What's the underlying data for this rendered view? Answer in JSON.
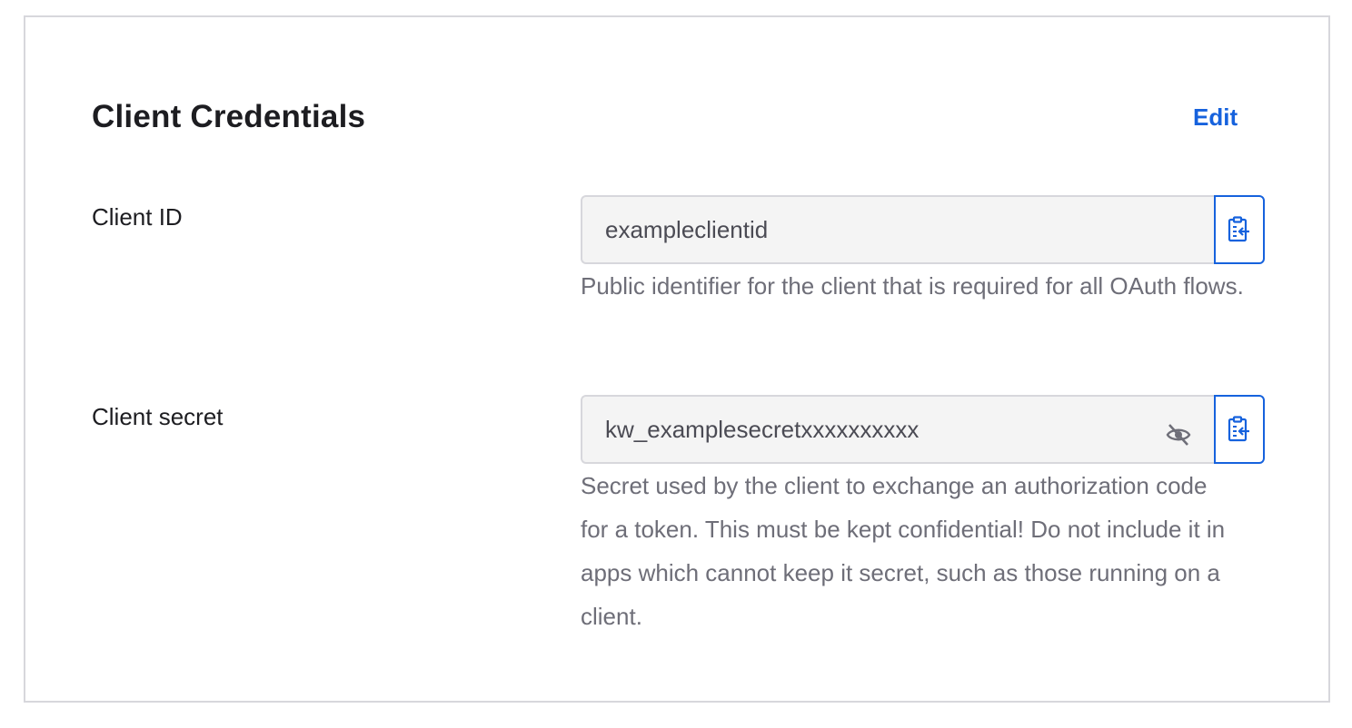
{
  "section": {
    "title": "Client Credentials",
    "edit_label": "Edit"
  },
  "client_id": {
    "label": "Client ID",
    "value": "exampleclientid",
    "help": "Public identifier for the client that is required for all OAuth flows."
  },
  "client_secret": {
    "label": "Client secret",
    "value": "kw_examplesecretxxxxxxxxxx",
    "help": "Secret used by the client to exchange an authorization code for a token. This must be kept confidential! Do not include it in apps which cannot keep it secret, such as those running on a client."
  },
  "icons": {
    "copy": "clipboard-copy-icon",
    "visibility": "eye-slash-icon"
  },
  "colors": {
    "accent": "#1662dd",
    "title": "#1d1d21",
    "help_text": "#6e6e78",
    "input_bg": "#f4f4f4",
    "border": "#d7d7dc"
  }
}
